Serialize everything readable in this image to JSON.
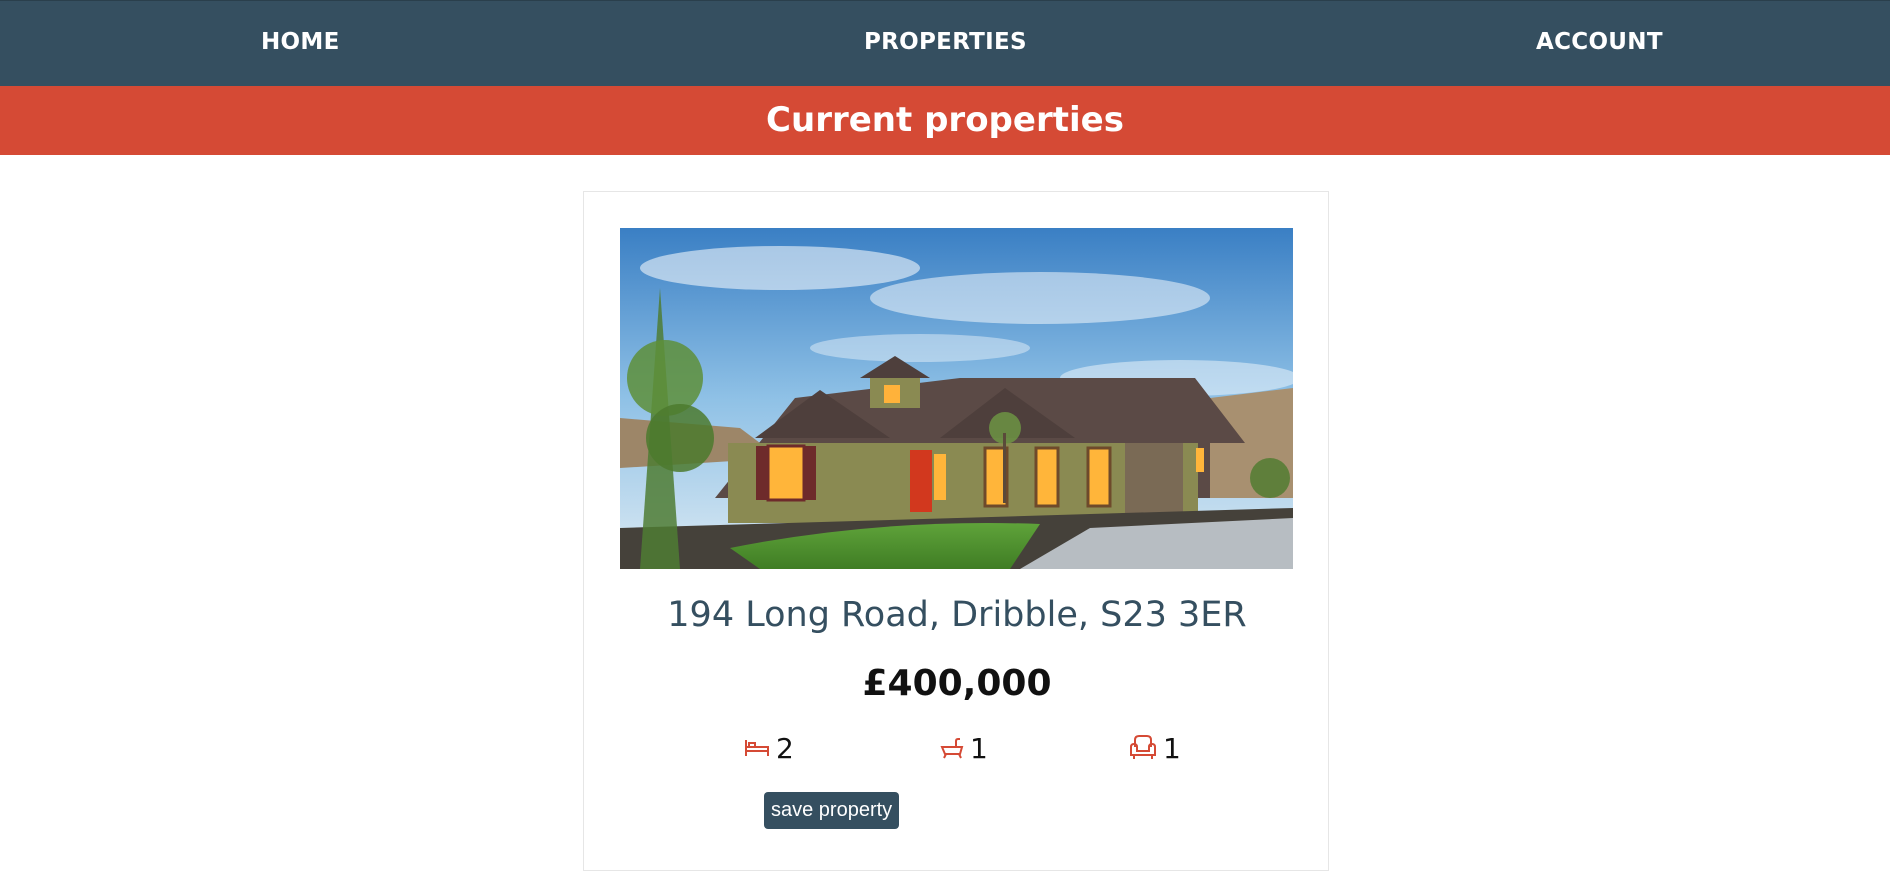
{
  "nav": {
    "home": "HOME",
    "properties": "PROPERTIES",
    "account": "ACCOUNT"
  },
  "banner": {
    "title": "Current properties"
  },
  "property": {
    "address": "194 Long Road, Dribble, S23 3ER",
    "price": "£400,000",
    "bedrooms": "2",
    "bathrooms": "1",
    "reception_rooms": "1",
    "save_label": "save property"
  },
  "colors": {
    "nav_bg": "#354f60",
    "banner_bg": "#d54a35",
    "accent_icon": "#d54a35",
    "button_bg": "#354f60"
  },
  "icons": [
    "bed-icon",
    "bath-icon",
    "armchair-icon"
  ]
}
